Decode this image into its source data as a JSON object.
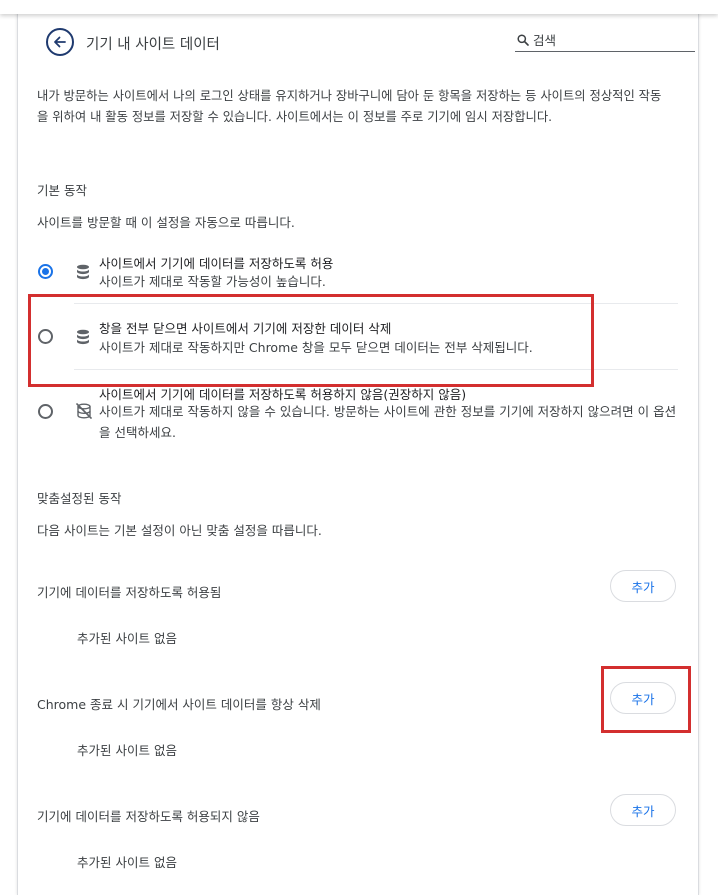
{
  "header": {
    "title": "기기 내 사이트 데이터",
    "search_placeholder": "검색"
  },
  "description": "내가 방문하는 사이트에서 나의 로그인 상태를 유지하거나 장바구니에 담아 둔 항목을 저장하는 등 사이트의 정상적인 작동을 위하여 내 활동 정보를 저장할 수 있습니다. 사이트에서는 이 정보를 주로 기기에 임시 저장합니다.",
  "default_behavior": {
    "title": "기본 동작",
    "subtitle": "사이트를 방문할 때 이 설정을 자동으로 따릅니다.",
    "options": [
      {
        "title": "사이트에서 기기에 데이터를 저장하도록 허용",
        "subtitle": "사이트가 제대로 작동할 가능성이 높습니다.",
        "selected": true,
        "icon": "database-icon"
      },
      {
        "title": "창을 전부 닫으면 사이트에서 기기에 저장한 데이터 삭제",
        "subtitle": "사이트가 제대로 작동하지만 Chrome 창을 모두 닫으면 데이터는 전부 삭제됩니다.",
        "selected": false,
        "icon": "database-icon"
      },
      {
        "title": "사이트에서 기기에 데이터를 저장하도록 허용하지 않음(권장하지 않음)",
        "subtitle": "사이트가 제대로 작동하지 않을 수 있습니다. 방문하는 사이트에 관한 정보를 기기에 저장하지 않으려면 이 옵션을 선택하세요.",
        "selected": false,
        "icon": "database-off-icon"
      }
    ]
  },
  "custom_behavior": {
    "title": "맞춤설정된 동작",
    "subtitle": "다음 사이트는 기본 설정이 아닌 맞춤 설정을 따릅니다.",
    "groups": [
      {
        "label": "기기에 데이터를 저장하도록 허용됨",
        "button": "추가",
        "empty": "추가된 사이트 없음"
      },
      {
        "label": "Chrome 종료 시 기기에서 사이트 데이터를 항상 삭제",
        "button": "추가",
        "empty": "추가된 사이트 없음"
      },
      {
        "label": "기기에 데이터를 저장하도록 허용되지 않음",
        "button": "추가",
        "empty": "추가된 사이트 없음"
      }
    ]
  },
  "colors": {
    "accent": "#1a73e8",
    "highlight": "#d32f2f",
    "text": "#3c4043"
  }
}
